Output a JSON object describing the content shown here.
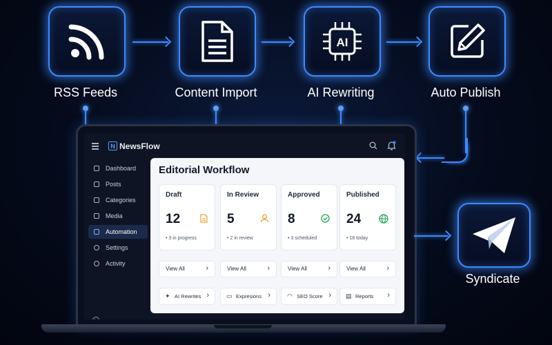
{
  "workflow": {
    "steps": [
      {
        "label": "RSS Feeds",
        "icon": "rss-icon"
      },
      {
        "label": "Content Import",
        "icon": "document-icon"
      },
      {
        "label": "AI Rewriting",
        "icon": "ai-chip-icon",
        "icon_text": "AI"
      },
      {
        "label": "Auto Publish",
        "icon": "edit-publish-icon"
      }
    ],
    "syndicate": {
      "label": "Syndicate",
      "icon": "paper-plane-icon"
    },
    "accent_color": "#3d8bff"
  },
  "app": {
    "brand": "NewsFlow",
    "brand_logo_letter": "N",
    "header_icons": [
      "search-icon",
      "bell-icon"
    ],
    "sidebar": {
      "items": [
        {
          "label": "Dashboard",
          "icon": "home-icon",
          "active": false
        },
        {
          "label": "Posts",
          "icon": "edit-icon",
          "active": false
        },
        {
          "label": "Categories",
          "icon": "folder-icon",
          "active": false
        },
        {
          "label": "Media",
          "icon": "image-icon",
          "active": false
        },
        {
          "label": "Automation",
          "icon": "lightning-icon",
          "active": true
        },
        {
          "label": "Settings",
          "icon": "gear-icon",
          "active": false
        },
        {
          "label": "Activity",
          "icon": "activity-icon",
          "active": false
        }
      ]
    },
    "main": {
      "title": "Editorial Workflow",
      "cards": [
        {
          "title": "Draft",
          "count": "12",
          "icon": "document-icon",
          "icon_color": "#f0a030",
          "sub": "3 in progress",
          "link": "View All"
        },
        {
          "title": "In Review",
          "count": "5",
          "icon": "user-icon",
          "icon_color": "#f0a030",
          "sub": "2 in review",
          "link": "View All"
        },
        {
          "title": "Approved",
          "count": "8",
          "icon": "check-circle-icon",
          "icon_color": "#22a559",
          "sub": "3 scheduled",
          "link": "View All"
        },
        {
          "title": "Published",
          "count": "24",
          "icon": "globe-icon",
          "icon_color": "#22a559",
          "sub": "18 today",
          "link": "View All"
        }
      ],
      "tools": [
        {
          "label": "AI Rewrites",
          "icon": "sparkle-icon"
        },
        {
          "label": "Expresions",
          "icon": "chat-icon"
        },
        {
          "label": "SEO Score",
          "icon": "gauge-icon"
        },
        {
          "label": "Reports",
          "icon": "report-icon"
        }
      ]
    }
  }
}
